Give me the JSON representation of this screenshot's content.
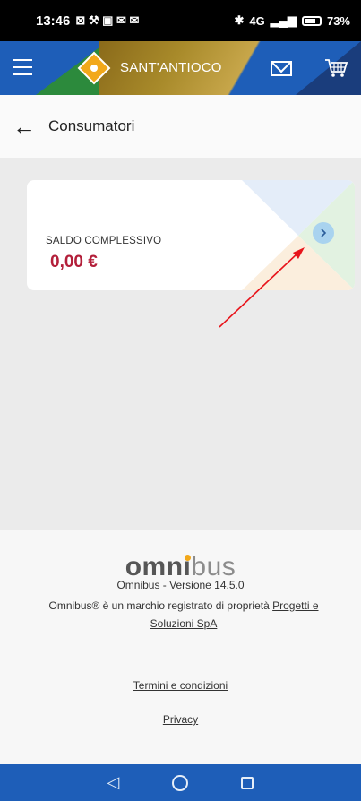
{
  "status_bar": {
    "time": "13:46",
    "signal_label": "4G",
    "battery": "73%"
  },
  "header": {
    "brand": "SANT'ANTIOCO",
    "colors": {
      "bar": "#1e5eb8",
      "green": "#2c8a3c",
      "gold": "#c7a64a",
      "logo": "#f2a81a"
    },
    "icons": [
      "menu-icon",
      "logo-icon",
      "mail-icon",
      "cart-icon"
    ]
  },
  "page": {
    "title": "Consumatori"
  },
  "balance_card": {
    "label": "SALDO COMPLESSIVO",
    "value": "0,00 €",
    "value_color": "#b31f3a"
  },
  "footer": {
    "logo_bold": "omn",
    "logo_i": "i",
    "logo_light": "bus",
    "version": "Omnibus - Versione 14.5.0",
    "trademark_text": "Omnibus® è un marchio registrato di proprietà",
    "trademark_link": "Progetti e Soluzioni SpA",
    "terms": "Termini e condizioni",
    "privacy": "Privacy"
  },
  "nav_bar": {
    "icons": [
      "back-nav-icon",
      "home-nav-icon",
      "recents-nav-icon"
    ]
  }
}
